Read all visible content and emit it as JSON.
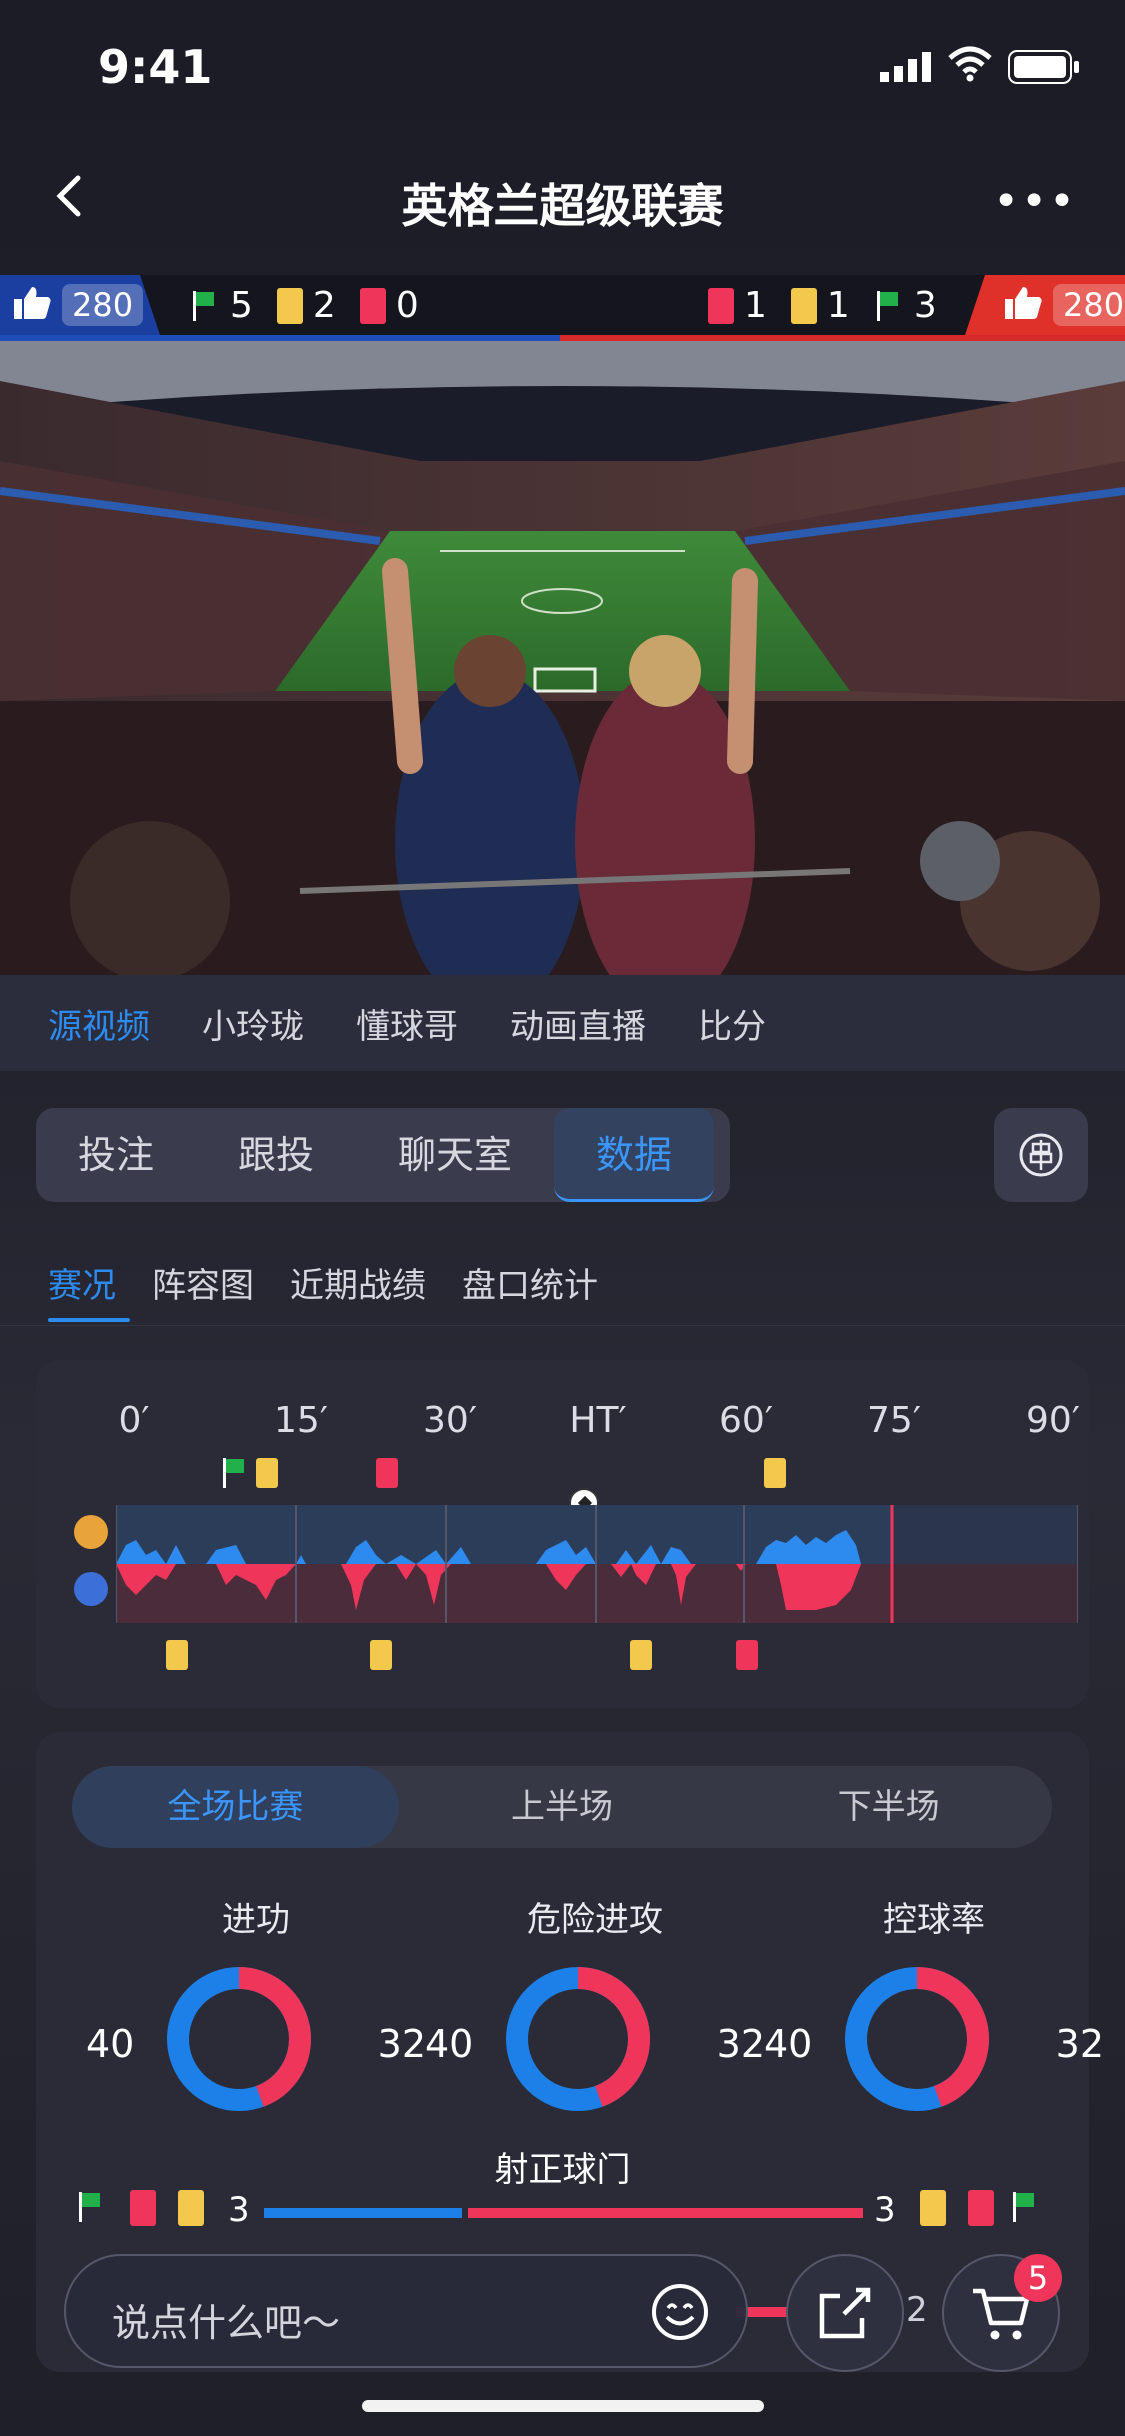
{
  "status_bar": {
    "time": "9:41"
  },
  "nav": {
    "title": "英格兰超级联赛"
  },
  "score_strip": {
    "home_likes": "280",
    "away_likes": "280",
    "home": {
      "corners": "5",
      "yellow": "2",
      "red": "0"
    },
    "away": {
      "red": "1",
      "yellow": "1",
      "corners": "3"
    }
  },
  "source_tabs": [
    "源视频",
    "小玲珑",
    "懂球哥",
    "动画直播",
    "比分"
  ],
  "main_tabs": [
    "投注",
    "跟投",
    "聊天室",
    "数据"
  ],
  "sub_tabs": [
    "赛况",
    "阵容图",
    "近期战绩",
    "盘口统计"
  ],
  "timeline": {
    "ticks": [
      "0′",
      "15′",
      "30′",
      "HT′",
      "60′",
      "75′",
      "90′"
    ]
  },
  "stats": {
    "segments": [
      "全场比赛",
      "上半场",
      "下半场"
    ],
    "donuts": [
      {
        "label": "进功",
        "home": "40",
        "away": "32"
      },
      {
        "label": "危险进攻",
        "home": "40",
        "away": "32"
      },
      {
        "label": "控球率",
        "home": "40",
        "away": "32"
      }
    ],
    "shots_on_target": {
      "label": "射正球门",
      "home": "3",
      "away": "3"
    },
    "partial_value": "2"
  },
  "bottom": {
    "input_placeholder": "说点什么吧～",
    "cart_badge": "5"
  },
  "colors": {
    "accent": "#2d8bf0",
    "home": "#1d80e8",
    "away": "#f0355a",
    "yellow_card": "#f2c94c"
  }
}
